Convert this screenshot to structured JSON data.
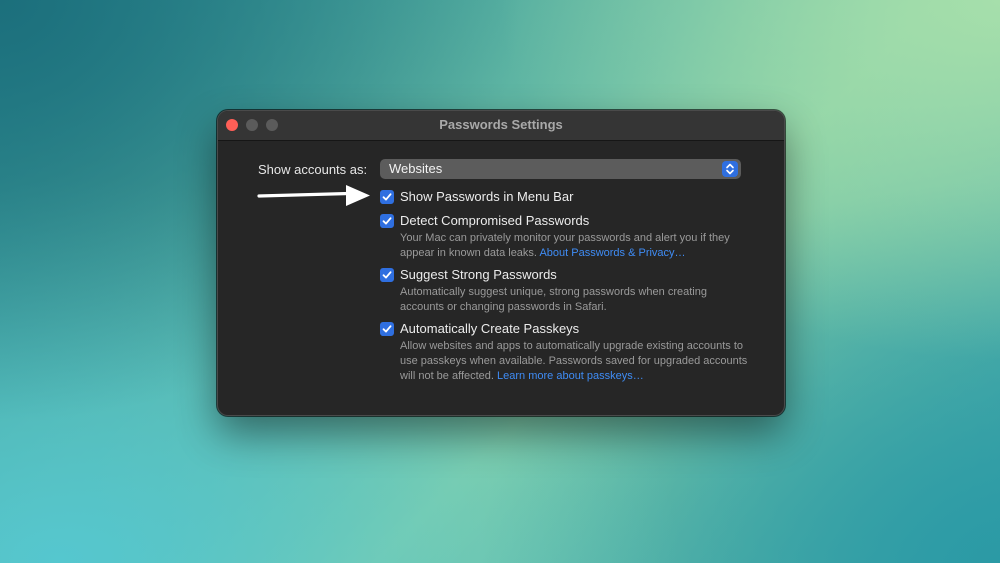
{
  "window": {
    "title": "Passwords Settings"
  },
  "show_accounts": {
    "label": "Show accounts as:",
    "selected": "Websites"
  },
  "options": [
    {
      "label": "Show Passwords in Menu Bar",
      "checked": true
    },
    {
      "label": "Detect Compromised Passwords",
      "checked": true,
      "description": "Your Mac can privately monitor your passwords and alert you if they appear in known data leaks.",
      "link": "About Passwords & Privacy…"
    },
    {
      "label": "Suggest Strong Passwords",
      "checked": true,
      "description": "Automatically suggest unique, strong passwords when creating accounts or changing passwords in Safari."
    },
    {
      "label": "Automatically Create Passkeys",
      "checked": true,
      "description": "Allow websites and apps to automatically upgrade existing accounts to use passkeys when available. Passwords saved for upgraded accounts will not be affected.",
      "link": "Learn more about passkeys…"
    }
  ],
  "colors": {
    "accent": "#2f6fe0",
    "link": "#3f8cf5",
    "close": "#ff5f57"
  }
}
